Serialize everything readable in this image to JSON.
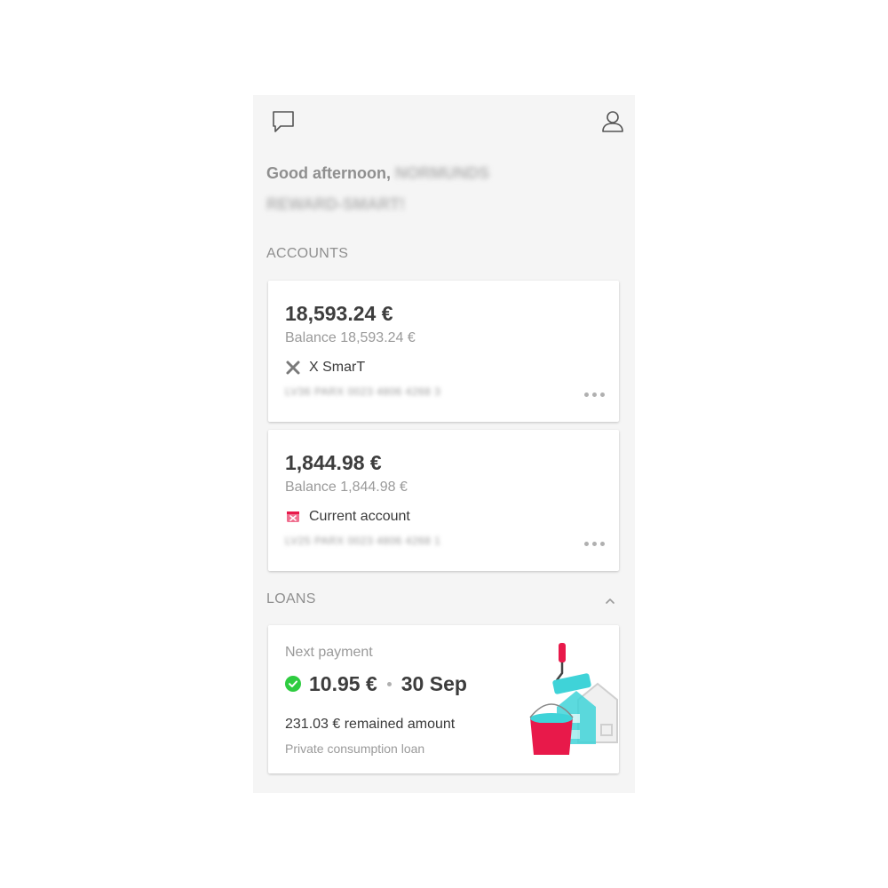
{
  "header": {
    "chat_icon": "chat-bubble-icon",
    "profile_icon": "user-icon"
  },
  "greeting": {
    "prefix": "Good afternoon,",
    "name_line1": "NORMUNDS",
    "name_line2": "REWARD-SMART!"
  },
  "accounts": {
    "title": "ACCOUNTS",
    "items": [
      {
        "amount": "18,593.24 €",
        "balance": "Balance 18,593.24 €",
        "name": "X SmarT",
        "icon": "x-smart-icon",
        "iban": "LV36 PARX 0023 4806 4268 3"
      },
      {
        "amount": "1,844.98 €",
        "balance": "Balance 1,844.98 €",
        "name": "Current account",
        "icon": "current-account-icon",
        "iban": "LV25 PARX 0023 4806 4268 1"
      }
    ]
  },
  "loans": {
    "title": "LOANS",
    "next_payment_label": "Next payment",
    "amount": "10.95 €",
    "date": "30 Sep",
    "remained": "231.03 € remained amount",
    "type": "Private consumption loan"
  },
  "colors": {
    "brand_red": "#e8194a",
    "accent_teal": "#3fd3d8",
    "success_green": "#2ecc40",
    "background": "#f5f5f5"
  }
}
